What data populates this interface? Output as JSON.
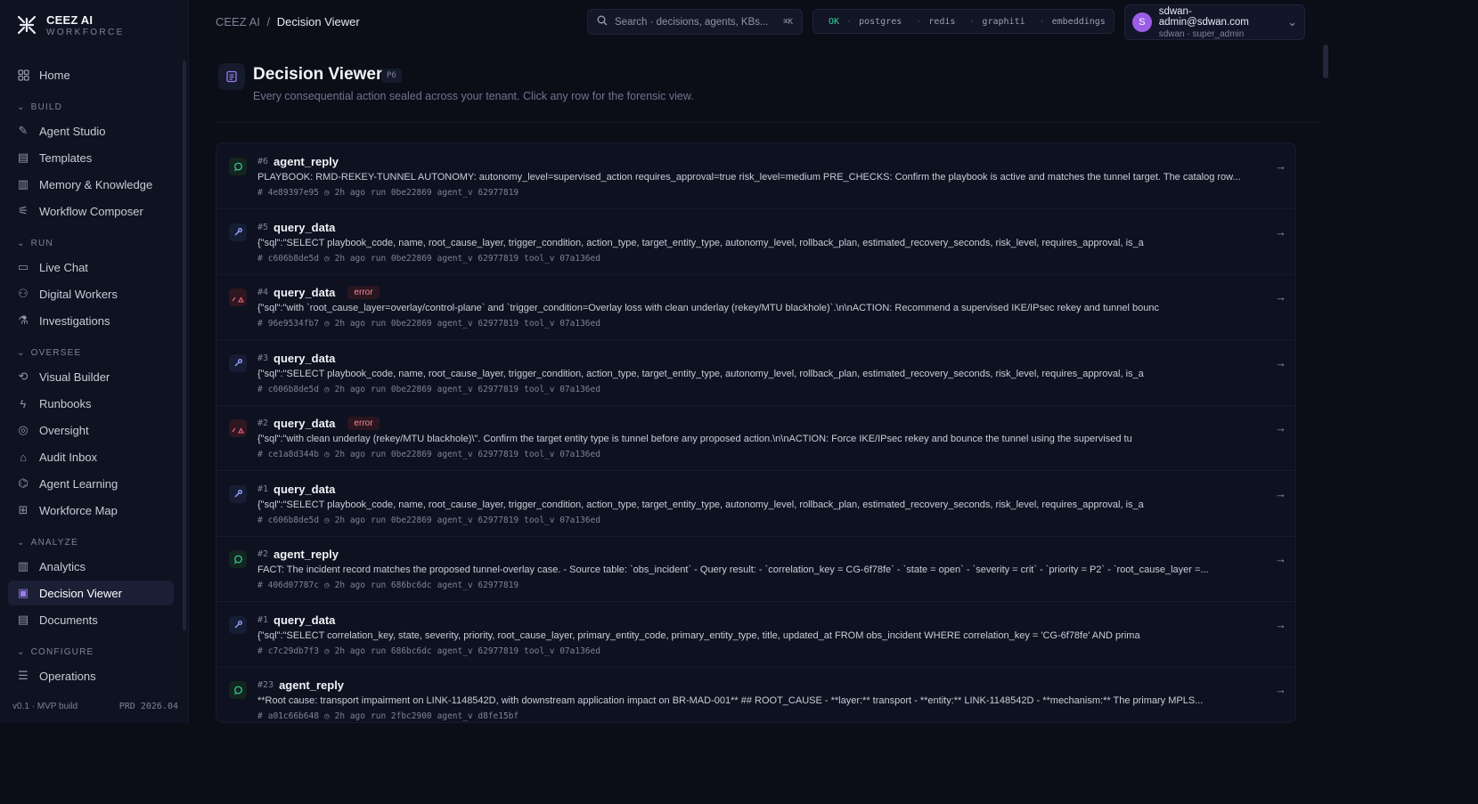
{
  "brand": {
    "name": "CEEZ AI",
    "tagline": "WORKFORCE"
  },
  "sidebar": {
    "home": "Home",
    "sections": [
      {
        "label": "BUILD",
        "items": [
          "Agent Studio",
          "Templates",
          "Memory & Knowledge",
          "Workflow Composer"
        ]
      },
      {
        "label": "RUN",
        "items": [
          "Live Chat",
          "Digital Workers",
          "Investigations"
        ]
      },
      {
        "label": "OVERSEE",
        "items": [
          "Visual Builder",
          "Runbooks",
          "Oversight",
          "Audit Inbox",
          "Agent Learning",
          "Workforce Map"
        ]
      },
      {
        "label": "ANALYZE",
        "items": [
          "Analytics",
          "Decision Viewer",
          "Documents"
        ]
      },
      {
        "label": "CONFIGURE",
        "items": [
          "Operations"
        ]
      }
    ],
    "active": "Decision Viewer",
    "footer_left": "v0.1 · MVP build",
    "footer_right": "PRD 2026.04"
  },
  "topbar": {
    "breadcrumb_root": "CEEZ AI",
    "breadcrumb_sep": "/",
    "breadcrumb_current": "Decision Viewer",
    "search_placeholder": "Search · decisions, agents, KBs...",
    "search_shortcut": "⌘K",
    "status_ok": "OK",
    "services": [
      "postgres",
      "redis",
      "graphiti",
      "embeddings"
    ],
    "user_email": "sdwan-admin@sdwan.com",
    "user_role": "sdwan · super_admin",
    "user_initial": "S"
  },
  "page": {
    "title": "Decision Viewer",
    "badge": "P6",
    "subtitle": "Every consequential action sealed across your tenant. Click any row for the forensic view."
  },
  "decisions": [
    {
      "num": "#6",
      "name": "agent_reply",
      "kind": "reply",
      "error": "",
      "body": "PLAYBOOK: RMD-REKEY-TUNNEL AUTONOMY: autonomy_level=supervised_action requires_approval=true risk_level=medium PRE_CHECKS: Confirm the playbook is active and matches the tunnel target. The catalog row...",
      "hash": "4e89397e95",
      "time": "2h ago",
      "run": "run 0be22869",
      "agent": "agent_v 62977819",
      "tool": ""
    },
    {
      "num": "#5",
      "name": "query_data",
      "kind": "tool",
      "error": "",
      "body": "{\"sql\":\"SELECT playbook_code, name, root_cause_layer, trigger_condition, action_type, target_entity_type, autonomy_level, rollback_plan, estimated_recovery_seconds, risk_level, requires_approval, is_a",
      "hash": "c606b8de5d",
      "time": "2h ago",
      "run": "run 0be22869",
      "agent": "agent_v 62977819",
      "tool": "tool_v 07a136ed"
    },
    {
      "num": "#4",
      "name": "query_data",
      "kind": "err",
      "error": "error",
      "body": "{\"sql\":\"with `root_cause_layer=overlay/control-plane` and `trigger_condition=Overlay loss with clean underlay (rekey/MTU blackhole)`.\\n\\nACTION: Recommend a supervised IKE/IPsec rekey and tunnel bounc",
      "hash": "96e9534fb7",
      "time": "2h ago",
      "run": "run 0be22869",
      "agent": "agent_v 62977819",
      "tool": "tool_v 07a136ed"
    },
    {
      "num": "#3",
      "name": "query_data",
      "kind": "tool",
      "error": "",
      "body": "{\"sql\":\"SELECT playbook_code, name, root_cause_layer, trigger_condition, action_type, target_entity_type, autonomy_level, rollback_plan, estimated_recovery_seconds, risk_level, requires_approval, is_a",
      "hash": "c606b8de5d",
      "time": "2h ago",
      "run": "run 0be22869",
      "agent": "agent_v 62977819",
      "tool": "tool_v 07a136ed"
    },
    {
      "num": "#2",
      "name": "query_data",
      "kind": "err",
      "error": "error",
      "body": "{\"sql\":\"with clean underlay (rekey/MTU blackhole)\\\". Confirm the target entity type is tunnel before any proposed action.\\n\\nACTION: Force IKE/IPsec rekey and bounce the tunnel using the supervised tu",
      "hash": "ce1a8d344b",
      "time": "2h ago",
      "run": "run 0be22869",
      "agent": "agent_v 62977819",
      "tool": "tool_v 07a136ed"
    },
    {
      "num": "#1",
      "name": "query_data",
      "kind": "tool",
      "error": "",
      "body": "{\"sql\":\"SELECT playbook_code, name, root_cause_layer, trigger_condition, action_type, target_entity_type, autonomy_level, rollback_plan, estimated_recovery_seconds, risk_level, requires_approval, is_a",
      "hash": "c606b8de5d",
      "time": "2h ago",
      "run": "run 0be22869",
      "agent": "agent_v 62977819",
      "tool": "tool_v 07a136ed"
    },
    {
      "num": "#2",
      "name": "agent_reply",
      "kind": "reply",
      "error": "",
      "body": "FACT: The incident record matches the proposed tunnel-overlay case. - Source table: `obs_incident` - Query result: - `correlation_key = CG-6f78fe` - `state = open` - `severity = crit` - `priority = P2` - `root_cause_layer =...",
      "hash": "406d07787c",
      "time": "2h ago",
      "run": "run 686bc6dc",
      "agent": "agent_v 62977819",
      "tool": ""
    },
    {
      "num": "#1",
      "name": "query_data",
      "kind": "tool",
      "error": "",
      "body": "{\"sql\":\"SELECT correlation_key, state, severity, priority, root_cause_layer, primary_entity_code, primary_entity_type, title, updated_at FROM obs_incident WHERE correlation_key = 'CG-6f78fe' AND prima",
      "hash": "c7c29db7f3",
      "time": "2h ago",
      "run": "run 686bc6dc",
      "agent": "agent_v 62977819",
      "tool": "tool_v 07a136ed"
    },
    {
      "num": "#23",
      "name": "agent_reply",
      "kind": "reply",
      "error": "",
      "body": "**Root cause: transport impairment on LINK-1148542D, with downstream application impact on BR-MAD-001** ## ROOT_CAUSE - **layer:** transport - **entity:** LINK-1148542D - **mechanism:** The primary MPLS...",
      "hash": "a01c66b648",
      "time": "2h ago",
      "run": "run 2fbc2900",
      "agent": "agent_v d8fe15bf",
      "tool": ""
    }
  ]
}
